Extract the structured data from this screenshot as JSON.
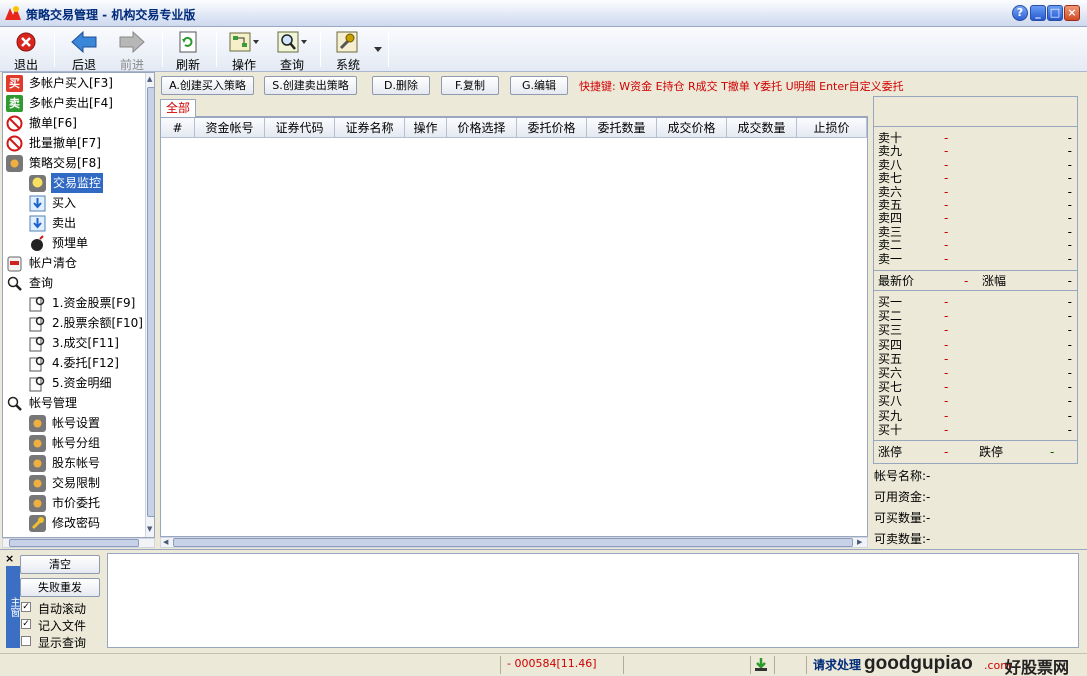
{
  "window": {
    "title": "策略交易管理 - 机构交易专业版"
  },
  "toolbar": {
    "exit": "退出",
    "back": "后退",
    "forward": "前进",
    "refresh": "刷新",
    "operate": "操作",
    "query": "查询",
    "system": "系统"
  },
  "tree": {
    "items": [
      "多帐户买入[F3]",
      "多帐户卖出[F4]",
      "撤单[F6]",
      "批量撤单[F7]",
      "策略交易[F8]",
      "交易监控",
      "买入",
      "卖出",
      "预埋单",
      "帐户清仓",
      "查询",
      "1.资金股票[F9]",
      "2.股票余额[F10]",
      "3.成交[F11]",
      "4.委托[F12]",
      "5.资金明细",
      "帐号管理",
      "帐号设置",
      "帐号分组",
      "股东帐号",
      "交易限制",
      "市价委托",
      "修改密码"
    ],
    "buy_badge": "买",
    "sell_badge": "卖"
  },
  "actions": {
    "create_buy": "A.创建买入策略",
    "create_sell": "S.创建卖出策略",
    "delete": "D.删除",
    "copy": "F.复制",
    "edit": "G.编辑",
    "hotkeys": "快捷键: W资金 E持仓 R成交 T撤单 Y委托 U明细 Enter自定义委托"
  },
  "grid": {
    "tab": "全部",
    "columns": [
      "#",
      "资金帐号",
      "证券代码",
      "证券名称",
      "操作",
      "价格选择",
      "委托价格",
      "委托数量",
      "成交价格",
      "成交数量",
      "止损价"
    ]
  },
  "quote": {
    "sell_levels": [
      "卖十",
      "卖九",
      "卖八",
      "卖七",
      "卖六",
      "卖五",
      "卖四",
      "卖三",
      "卖二",
      "卖一"
    ],
    "buy_levels": [
      "买一",
      "买二",
      "买三",
      "买四",
      "买五",
      "买六",
      "买七",
      "买八",
      "买九",
      "买十"
    ],
    "dash": "-",
    "latest_label": "最新价",
    "change_label": "涨幅",
    "limit_up_label": "涨停",
    "limit_down_label": "跌停"
  },
  "account": {
    "name": "帐号名称:-",
    "funds": "可用资金:-",
    "buyable": "可买数量:-",
    "sellable": "可卖数量:-"
  },
  "log": {
    "clear": "清空",
    "retry": "失败重发",
    "auto_scroll": "自动滚动",
    "write_file": "记入文件",
    "show_query": "显示查询",
    "side_label": "主窗"
  },
  "status": {
    "quote": "- 000584[11.46]",
    "request": "请求处理",
    "watermark_brand": "goodgupiao",
    "watermark_tld": ".com",
    "watermark_cn": "好股票网"
  },
  "colors": {
    "accent_red": "#d00000",
    "title_blue": "#002a7a",
    "selection": "#316ac5"
  }
}
